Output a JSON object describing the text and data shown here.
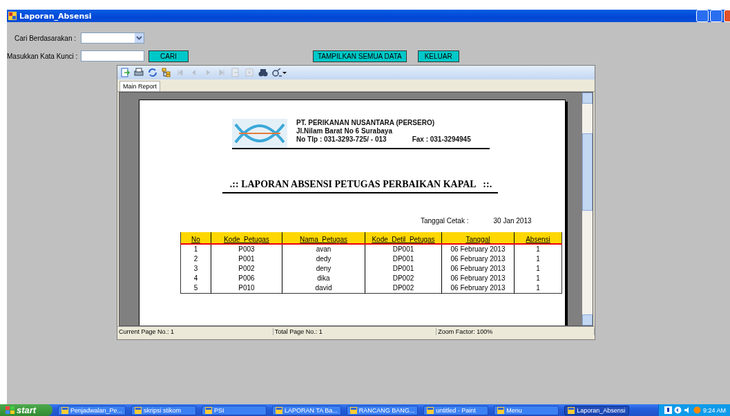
{
  "window": {
    "title": "Laporan_Absensi"
  },
  "form": {
    "search_by": {
      "label": "Cari Berdasarakan :"
    },
    "keyword": {
      "label": "Masukkan Kata Kunci :"
    },
    "buttons": [
      {
        "label": "CARI",
        "kind": "search"
      },
      {
        "label": "TAMPILKAN SEMUA DATA",
        "kind": "all"
      },
      {
        "label": "KELUAR",
        "kind": "exit"
      }
    ]
  },
  "viewer": {
    "toolbar": [
      {
        "kind": "export",
        "disabled": false
      },
      {
        "kind": "print",
        "disabled": false
      },
      {
        "kind": "refresh",
        "disabled": false
      },
      {
        "kind": "tree",
        "disabled": false
      },
      {
        "kind": "first",
        "disabled": true
      },
      {
        "kind": "prev",
        "disabled": true
      },
      {
        "kind": "next",
        "disabled": true
      },
      {
        "kind": "last",
        "disabled": true
      },
      {
        "kind": "goto",
        "disabled": true
      },
      {
        "kind": "stop",
        "disabled": true
      },
      {
        "kind": "find",
        "disabled": false
      },
      {
        "kind": "zoom",
        "disabled": false
      }
    ],
    "tabs": [
      {
        "label": "Main Report",
        "selected": true
      }
    ],
    "report": {
      "company": [
        "PT. PERIKANAN NUSANTARA (PERSERO)",
        "Jl.Nilam Barat No 6 Surabaya"
      ],
      "phone": "No Tlp : 031-3293-725/ - 013",
      "fax": "Fax : 031-3294945",
      "title": ".:: LAPORAN ABSENSI PETUGAS PERBAIKAN KAPAL   ::.",
      "print_date_label": "Tanggal Cetak :",
      "print_date": "30 Jan 2013",
      "table": {
        "columns": [
          "No",
          "Kode_Petugas",
          "Nama_Petugas",
          "Kode_Detil_Petugas",
          "Tanggal",
          "Absensi"
        ],
        "rows": [
          [
            "1",
            "P003",
            "avan",
            "DP001",
            "06 February 2013",
            "1"
          ],
          [
            "2",
            "P001",
            "dedy",
            "DP001",
            "06 February 2013",
            "1"
          ],
          [
            "3",
            "P002",
            "deny",
            "DP001",
            "06 February 2013",
            "1"
          ],
          [
            "4",
            "P006",
            "dika",
            "DP002",
            "06 February 2013",
            "1"
          ],
          [
            "5",
            "P010",
            "david",
            "DP002",
            "06 February 2013",
            "1"
          ]
        ]
      }
    },
    "status_bar": [
      "Current Page No.: 1",
      "Total Page No.: 1",
      "Zoom Factor: 100%"
    ]
  },
  "taskbar": {
    "start": "start",
    "items": [
      {
        "label": "Penjadwalan_Pe...",
        "selected": false
      },
      {
        "label": "skripsi stikom",
        "selected": false
      },
      {
        "label": "PSI",
        "selected": false
      },
      {
        "label": "LAPORAN TA Ba...",
        "selected": false
      },
      {
        "label": "RANCANG BANG...",
        "selected": false
      },
      {
        "label": "untitled - Paint",
        "selected": false
      },
      {
        "label": "Menu",
        "selected": false
      },
      {
        "label": "Laporan_Absensi",
        "selected": true
      }
    ],
    "clock": "9:24 AM"
  }
}
